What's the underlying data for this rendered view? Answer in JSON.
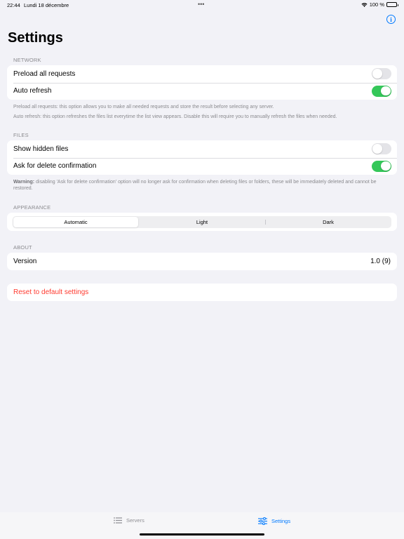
{
  "status_bar": {
    "time": "22:44",
    "date": "Lundi 18 décembre",
    "dots": "•••",
    "battery_text": "100 %"
  },
  "header": {
    "title": "Settings",
    "info_icon": "info-circle-icon",
    "info_glyph": "i"
  },
  "network": {
    "header": "NETWORK",
    "rows": [
      {
        "label": "Preload all requests",
        "toggle_on": false
      },
      {
        "label": "Auto refresh",
        "toggle_on": true
      }
    ],
    "footer_line1": "Preload all requests: this option allows you to make all needed requests and store the result before selecting any server.",
    "footer_line2": "Auto refresh: this option refreshes the files list everytime the list view appears. Disable this will require you to manually refresh the files when needed."
  },
  "files": {
    "header": "FILES",
    "rows": [
      {
        "label": "Show hidden files",
        "toggle_on": false
      },
      {
        "label": "Ask for delete confirmation",
        "toggle_on": true
      }
    ],
    "footer_bold": "Warning:",
    "footer_text": " disabling 'Ask for delete confirmation' option will no longer ask for confirmation when deleting files or folders, these will be immediately deleted and cannot be restored."
  },
  "appearance": {
    "header": "APPEARANCE",
    "segments": [
      "Automatic",
      "Light",
      "Dark"
    ],
    "selected": "Automatic"
  },
  "about": {
    "header": "ABOUT",
    "version_label": "Version",
    "version_value": "1.0 (9)"
  },
  "reset": {
    "label": "Reset to default settings"
  },
  "tab_bar": {
    "servers_label": "Servers",
    "settings_label": "Settings",
    "active_tab": "Settings"
  },
  "colors": {
    "accent": "#007aff",
    "toggle_on": "#34c759",
    "destructive": "#ff3b30",
    "background": "#f2f2f7"
  }
}
